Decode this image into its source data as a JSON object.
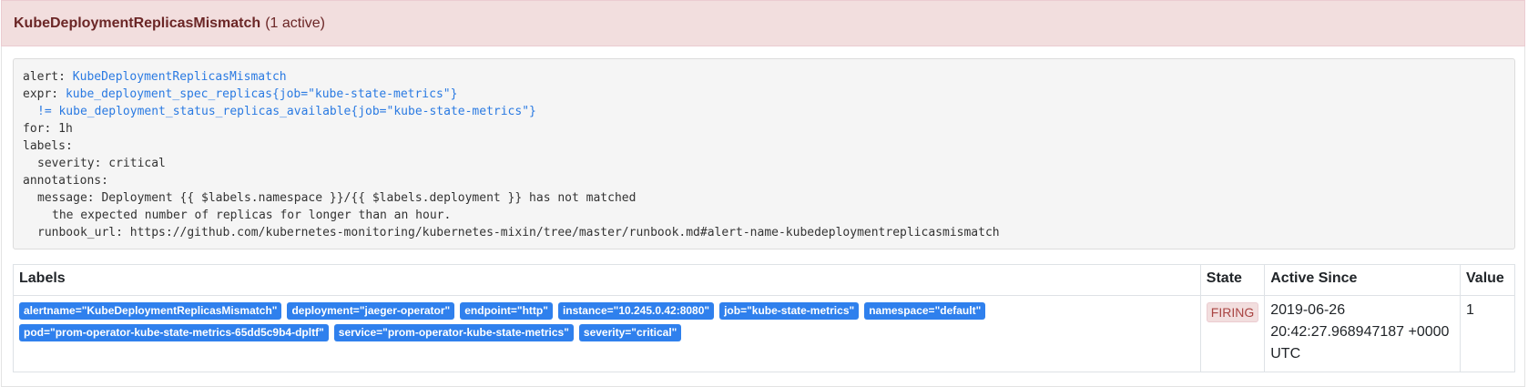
{
  "header": {
    "alert_name": "KubeDeploymentReplicasMismatch",
    "active_count": "(1 active)"
  },
  "rule": {
    "alert_key": "alert:",
    "alert_value": "KubeDeploymentReplicasMismatch",
    "expr_key": "expr:",
    "expr_line1": "kube_deployment_spec_replicas{job=\"kube-state-metrics\"}",
    "expr_line2": "!= kube_deployment_status_replicas_available{job=\"kube-state-metrics\"}",
    "for_line": "for: 1h",
    "labels_key": "labels:",
    "severity_line": "severity: critical",
    "annotations_key": "annotations:",
    "message_line1": "message: Deployment {{ $labels.namespace }}/{{ $labels.deployment }} has not matched",
    "message_line2": "the expected number of replicas for longer than an hour.",
    "runbook_line": "runbook_url: https://github.com/kubernetes-monitoring/kubernetes-mixin/tree/master/runbook.md#alert-name-kubedeploymentreplicasmismatch"
  },
  "table": {
    "headers": {
      "labels": "Labels",
      "state": "State",
      "active_since": "Active Since",
      "value": "Value"
    },
    "rows": [
      {
        "labels": [
          "alertname=\"KubeDeploymentReplicasMismatch\"",
          "deployment=\"jaeger-operator\"",
          "endpoint=\"http\"",
          "instance=\"10.245.0.42:8080\"",
          "job=\"kube-state-metrics\"",
          "namespace=\"default\"",
          "pod=\"prom-operator-kube-state-metrics-65dd5c9b4-dpltf\"",
          "service=\"prom-operator-kube-state-metrics\"",
          "severity=\"critical\""
        ],
        "state": "FIRING",
        "active_since_line1": "2019-06-26",
        "active_since_line2": "20:42:27.968947187 +0000",
        "active_since_line3": "UTC",
        "value": "1"
      }
    ]
  },
  "colors": {
    "header_bg": "#f2dede",
    "label_chip": "#2f80ed",
    "firing": "#a94442",
    "code_blue": "#2a7ae2"
  }
}
